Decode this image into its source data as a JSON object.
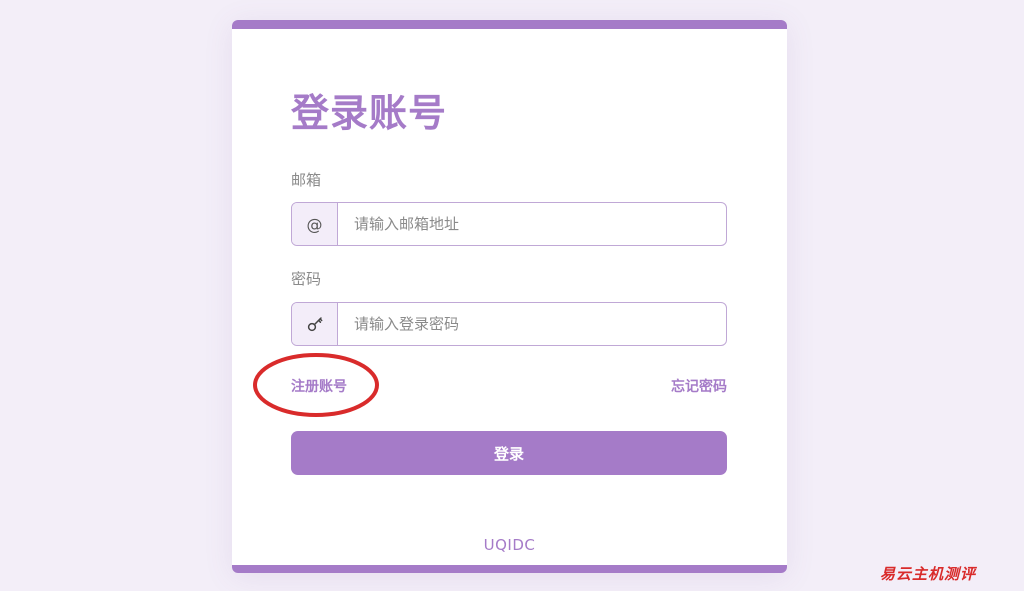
{
  "login": {
    "title": "登录账号",
    "email": {
      "label": "邮箱",
      "icon": "@",
      "placeholder": "请输入邮箱地址"
    },
    "password": {
      "label": "密码",
      "icon": "key",
      "placeholder": "请输入登录密码"
    },
    "register_link": "注册账号",
    "forgot_link": "忘记密码",
    "submit_label": "登录",
    "footer_brand": "UQIDC"
  },
  "watermark": "易云主机测评",
  "colors": {
    "accent": "#a57bc8",
    "page_background": "#f3eef8",
    "annotation": "#d92b2b"
  }
}
